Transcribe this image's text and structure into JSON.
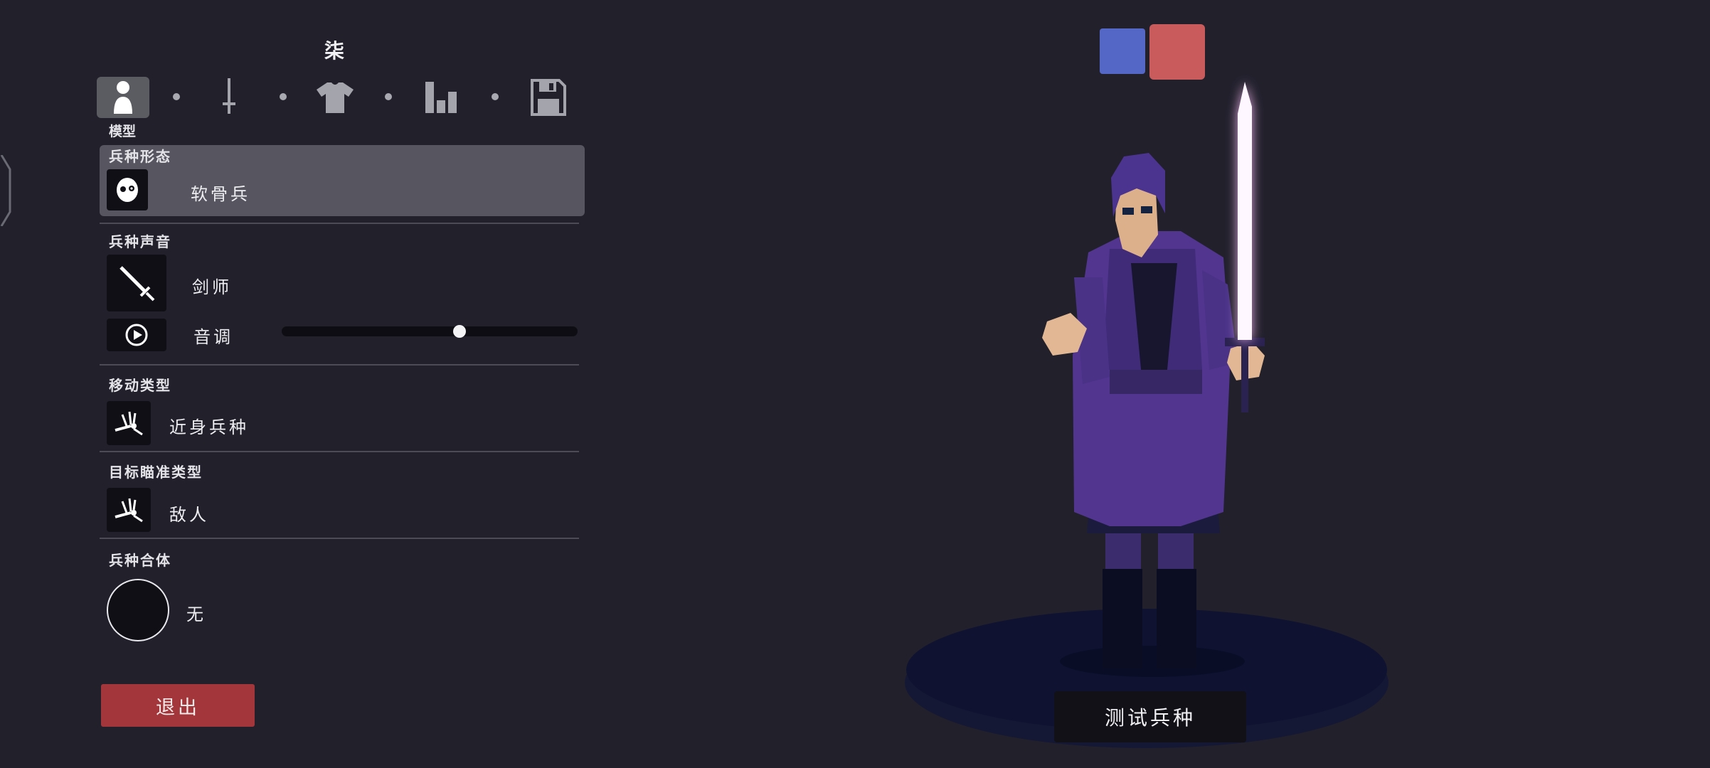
{
  "unit_name": "柒",
  "tabs": [
    {
      "icon": "person-icon"
    },
    {
      "icon": "sword-icon"
    },
    {
      "icon": "shirt-icon"
    },
    {
      "icon": "stats-icon"
    },
    {
      "icon": "save-icon"
    }
  ],
  "active_tab_label": "模型",
  "sections": {
    "form": {
      "label": "兵种形态",
      "value": "软骨兵",
      "icon": "skull-face-icon"
    },
    "voice": {
      "label": "兵种声音",
      "value": "剑师",
      "icon": "sword-icon",
      "pitch_label": "音调",
      "pitch_value": 0.6
    },
    "movement": {
      "label": "移动类型",
      "value": "近身兵种",
      "icon": "melee-icon"
    },
    "targeting": {
      "label": "目标瞄准类型",
      "value": "敌人",
      "icon": "target-enemy-icon"
    },
    "combine": {
      "label": "兵种合体",
      "value": "无"
    }
  },
  "exit_label": "退出",
  "test_label": "测试兵种",
  "team_colors": {
    "blue": "#5466c6",
    "red": "#c95b5c"
  }
}
